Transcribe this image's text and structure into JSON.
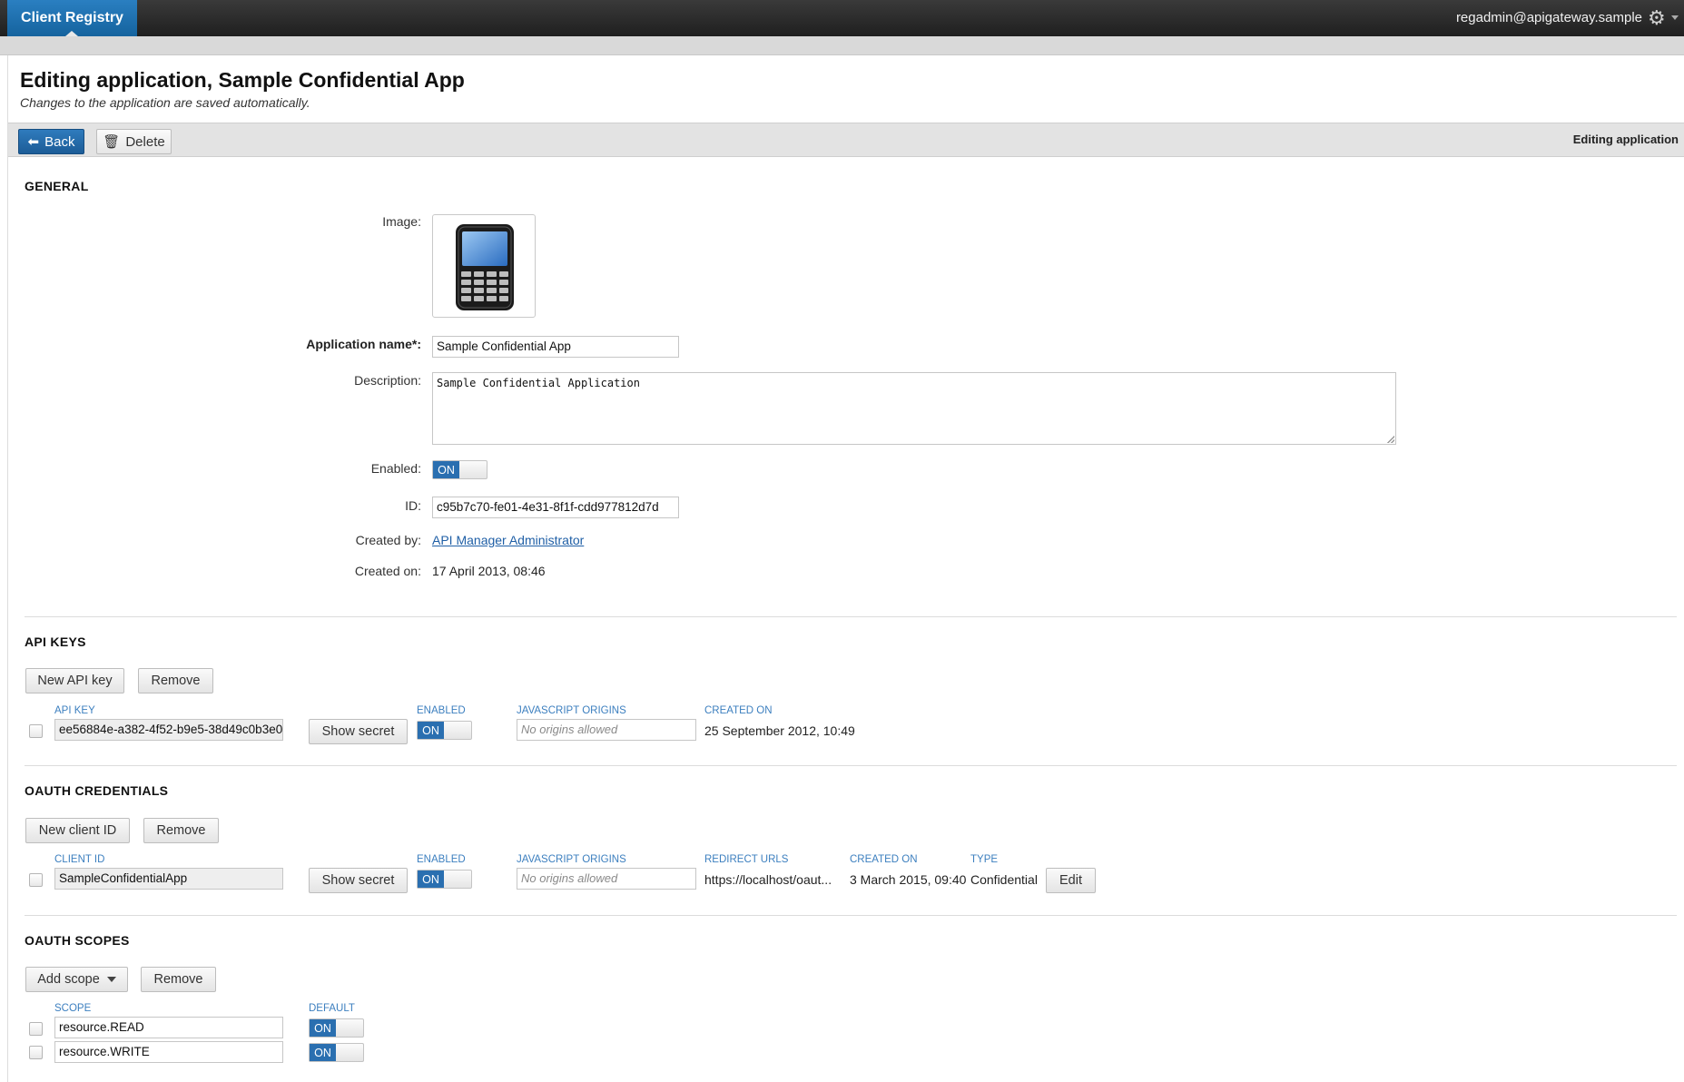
{
  "topbar": {
    "app_title": "Client Registry",
    "user_email": "regadmin@apigateway.sample",
    "settings_icon": "gear-icon"
  },
  "header": {
    "title": "Editing application, Sample Confidential App",
    "subtitle": "Changes to the application are saved automatically."
  },
  "toolbar": {
    "back_label": "Back",
    "delete_label": "Delete",
    "status": "Editing application"
  },
  "general": {
    "section_title": "GENERAL",
    "image_label": "Image:",
    "name_label": "Application name*:",
    "name_value": "Sample Confidential App",
    "description_label": "Description:",
    "description_value": "Sample Confidential Application",
    "enabled_label": "Enabled:",
    "enabled_value": "ON",
    "id_label": "ID:",
    "id_value": "c95b7c70-fe01-4e31-8f1f-cdd977812d7d",
    "created_by_label": "Created by:",
    "created_by_value": "API Manager Administrator",
    "created_on_label": "Created on:",
    "created_on_value": "17 April 2013, 08:46"
  },
  "api_keys": {
    "section_title": "API KEYS",
    "new_label": "New API key",
    "remove_label": "Remove",
    "columns": {
      "key": "API KEY",
      "enabled": "ENABLED",
      "origins": "JAVASCRIPT ORIGINS",
      "created_on": "CREATED ON"
    },
    "rows": [
      {
        "key": "ee56884e-a382-4f52-b9e5-38d49c0b3e0",
        "show_secret": "Show secret",
        "enabled": "ON",
        "origins_placeholder": "No origins allowed",
        "created_on": "25 September 2012, 10:49"
      }
    ]
  },
  "oauth_credentials": {
    "section_title": "OAUTH CREDENTIALS",
    "new_label": "New client ID",
    "remove_label": "Remove",
    "columns": {
      "client_id": "CLIENT ID",
      "enabled": "ENABLED",
      "origins": "JAVASCRIPT ORIGINS",
      "redirect": "REDIRECT URLS",
      "created_on": "CREATED ON",
      "type": "TYPE"
    },
    "rows": [
      {
        "client_id": "SampleConfidentialApp",
        "show_secret": "Show secret",
        "enabled": "ON",
        "origins_placeholder": "No origins allowed",
        "redirect": "https://localhost/oaut...",
        "created_on": "3 March 2015, 09:40",
        "type": "Confidential",
        "edit_label": "Edit"
      }
    ]
  },
  "oauth_scopes": {
    "section_title": "OAUTH SCOPES",
    "add_label": "Add scope",
    "remove_label": "Remove",
    "columns": {
      "scope": "SCOPE",
      "default": "DEFAULT"
    },
    "rows": [
      {
        "scope": "resource.READ",
        "default": "ON"
      },
      {
        "scope": "resource.WRITE",
        "default": "ON"
      }
    ]
  }
}
